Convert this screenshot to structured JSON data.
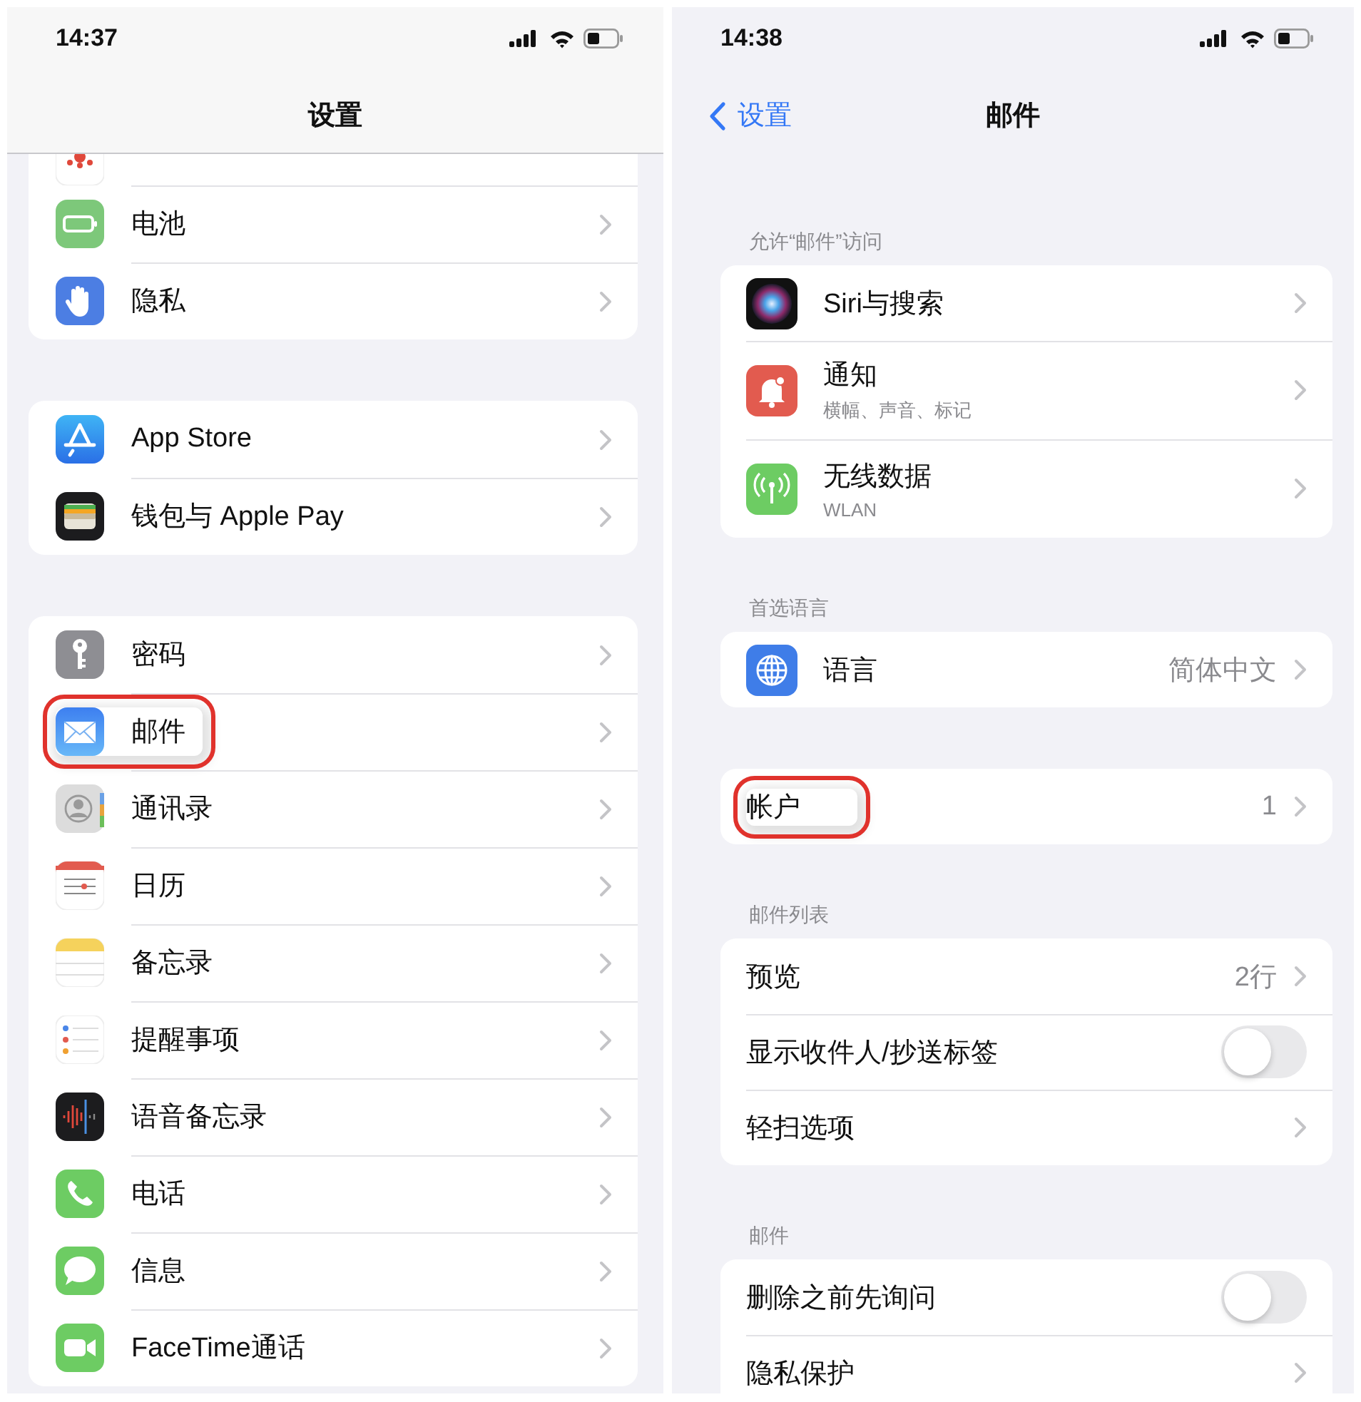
{
  "left_screen": {
    "status_bar": {
      "time": "14:37"
    },
    "title": "设置",
    "groups": [
      {
        "items": [
          {
            "label": "电池",
            "highlighted": false
          },
          {
            "label": "隐私",
            "highlighted": false
          }
        ]
      },
      {
        "items": [
          {
            "label": "App Store",
            "highlighted": false
          },
          {
            "label": "钱包与 Apple Pay",
            "highlighted": false
          }
        ]
      },
      {
        "items": [
          {
            "label": "密码",
            "highlighted": false
          },
          {
            "label": "邮件",
            "highlighted": true
          },
          {
            "label": "通讯录",
            "highlighted": false
          },
          {
            "label": "日历",
            "highlighted": false
          },
          {
            "label": "备忘录",
            "highlighted": false
          },
          {
            "label": "提醒事项",
            "highlighted": false
          },
          {
            "label": "语音备忘录",
            "highlighted": false
          },
          {
            "label": "电话",
            "highlighted": false
          },
          {
            "label": "信息",
            "highlighted": false
          },
          {
            "label": "FaceTime通话",
            "highlighted": false
          }
        ]
      }
    ]
  },
  "right_screen": {
    "status_bar": {
      "time": "14:38"
    },
    "back_button": "设置",
    "title": "邮件",
    "sections": [
      {
        "header": "允许“邮件”访问",
        "items": [
          {
            "kind": "nav",
            "label": "Siri与搜索",
            "highlighted": false
          },
          {
            "kind": "nav",
            "label": "通知",
            "subtitle": "横幅、声音、标记",
            "highlighted": false
          },
          {
            "kind": "nav",
            "label": "无线数据",
            "subtitle": "WLAN",
            "highlighted": false
          }
        ]
      },
      {
        "header": "首选语言",
        "items": [
          {
            "kind": "nav",
            "label": "语言",
            "value": "简体中文",
            "highlighted": false
          }
        ]
      },
      {
        "items": [
          {
            "kind": "nav",
            "label": "帐户",
            "value": "1",
            "highlighted": true
          }
        ]
      },
      {
        "header": "邮件列表",
        "items": [
          {
            "kind": "nav",
            "label": "预览",
            "value": "2行",
            "highlighted": false
          },
          {
            "kind": "toggle",
            "label": "显示收件人/抄送标签",
            "on": false,
            "highlighted": false
          },
          {
            "kind": "nav",
            "label": "轻扫选项",
            "highlighted": false
          }
        ]
      },
      {
        "header": "邮件",
        "items": [
          {
            "kind": "toggle",
            "label": "删除之前先询问",
            "on": false,
            "highlighted": false
          },
          {
            "kind": "nav",
            "label": "隐私保护",
            "highlighted": false
          }
        ]
      }
    ]
  }
}
